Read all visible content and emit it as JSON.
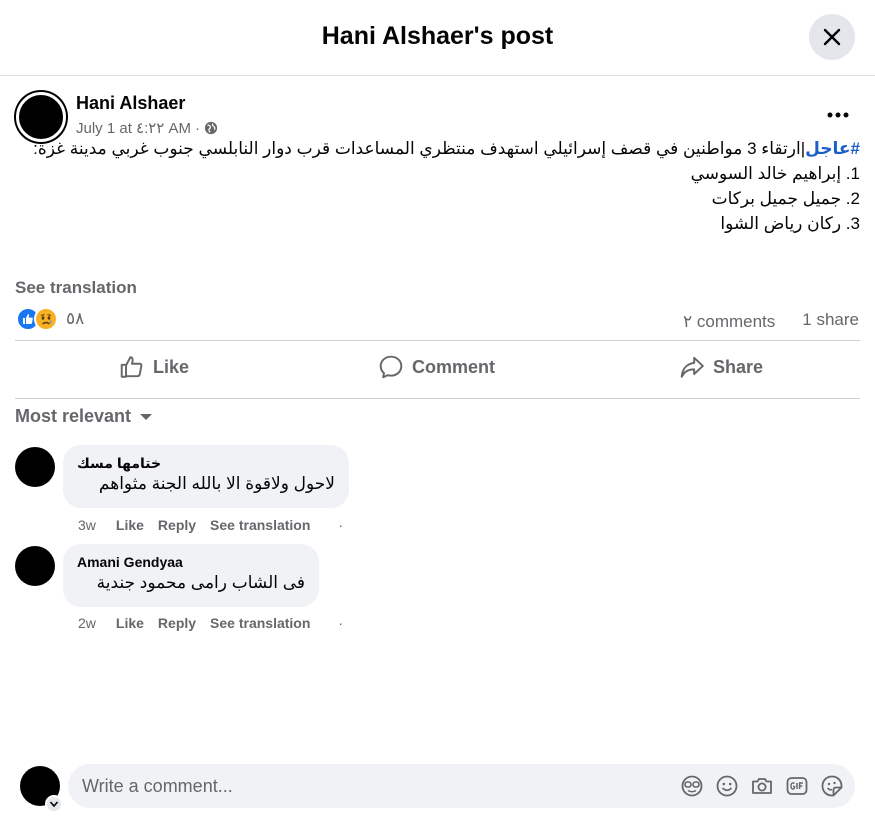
{
  "header": {
    "title": "Hani Alshaer's post"
  },
  "post": {
    "author": "Hani Alshaer",
    "date": "July 1 at ٤:٢٢ AM",
    "separator": "·",
    "privacy_icon": "globe-icon",
    "hashtag": "#عاجل",
    "body": "|ارتقاء 3 مواطنين في قصف إسرائيلي استهدف منتظري المساعدات قرب دوار النابلسي جنوب غربي مدينة غزة:",
    "list": [
      "1. إبراهيم خالد السوسي",
      "2. جميل جميل بركات",
      "3. ركان رياض الشوا"
    ],
    "see_translation": "See translation"
  },
  "stats": {
    "reactions": [
      "like-icon",
      "sad-icon"
    ],
    "reaction_count": "٥٨",
    "comments": "٢ comments",
    "shares": "1 share"
  },
  "actions": {
    "like": "Like",
    "comment": "Comment",
    "share": "Share"
  },
  "sort": {
    "label": "Most relevant"
  },
  "comments": [
    {
      "author": "ختامها مسك",
      "text": "لاحول ولاقوة الا بالله الجنة مثواهم",
      "age": "3w",
      "like": "Like",
      "reply": "Reply",
      "translate": "See translation",
      "dot": "·"
    },
    {
      "author": "Amani Gendyaa",
      "text": "فى الشاب رامى محمود جندية",
      "age": "2w",
      "like": "Like",
      "reply": "Reply",
      "translate": "See translation",
      "dot": "·"
    }
  ],
  "composer": {
    "placeholder": "Write a comment...",
    "tools": [
      "avatar-sticker-icon",
      "emoji-icon",
      "camera-icon",
      "gif-icon",
      "sticker-icon"
    ]
  },
  "colors": {
    "hashtag": "#1b5fc9",
    "secondary_text": "#65676b",
    "like_blue": "#1877f2",
    "sad_yellow": "#f7b125"
  }
}
